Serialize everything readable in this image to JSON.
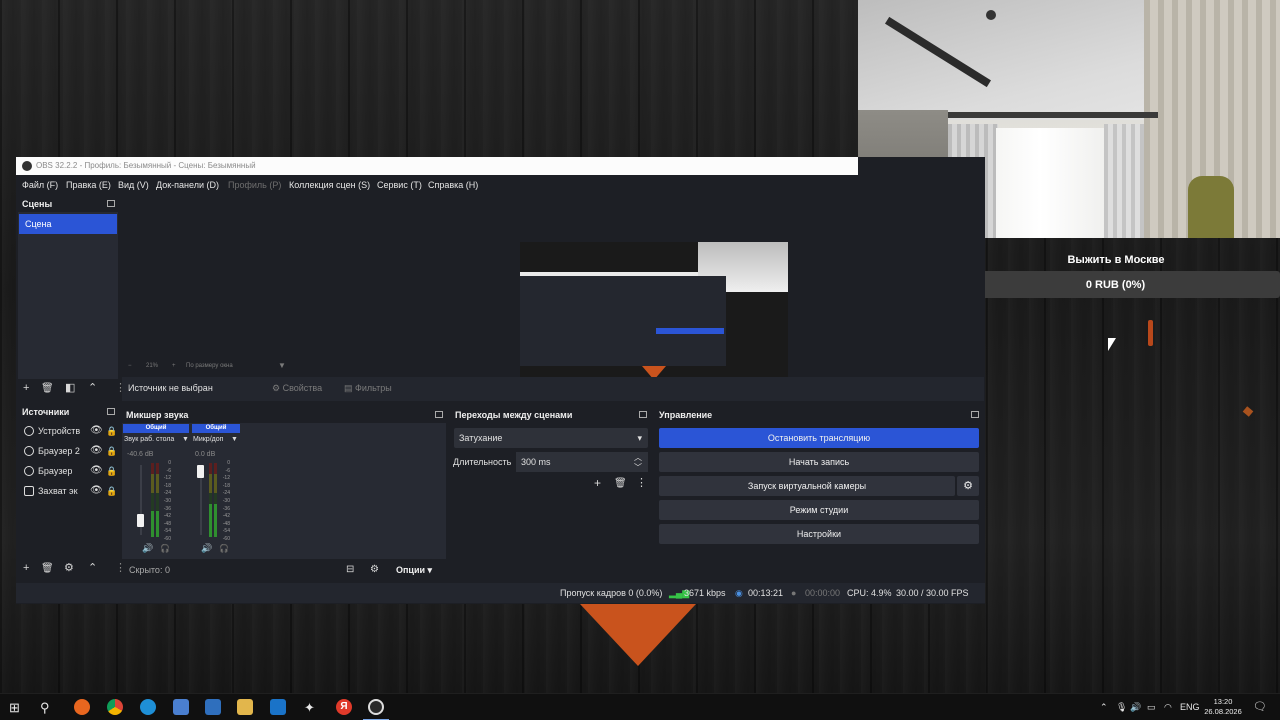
{
  "obs": {
    "title": "OBS 32.2.2 - Профиль: Безымянный - Сцены: Безымянный",
    "menu": [
      "Файл (F)",
      "Правка (E)",
      "Вид (V)",
      "Док-панели (D)",
      "Профиль (P)",
      "Коллекция сцен (S)",
      "Сервис (T)",
      "Справка (H)"
    ],
    "scenes": {
      "title": "Сцены",
      "items": [
        "Сцена"
      ]
    },
    "preview_zoom": {
      "percent": "21%",
      "mode": "По размеру окна"
    },
    "context": {
      "label": "Источник не выбран",
      "properties": "Свойства",
      "filters": "Фильтры"
    },
    "sources": {
      "title": "Источники",
      "items": [
        "Устройств",
        "Браузер 2",
        "Браузер",
        "Захват эк"
      ]
    },
    "mixer": {
      "title": "Микшер звука",
      "channels": [
        {
          "tab": "Общий",
          "name": "Звук раб. стола",
          "db": "-40.6 dB",
          "level": 0.35,
          "fader": 0.2
        },
        {
          "tab": "Общий",
          "name": "Микр/доп",
          "db": "0.0 dB",
          "level": 0.45,
          "fader": 1.0
        }
      ],
      "scale": [
        "0",
        "-6",
        "-12",
        "-18",
        "-24",
        "-30",
        "-36",
        "-42",
        "-48",
        "-54",
        "-60"
      ],
      "hidden": "Скрыто: 0",
      "options": "Опции"
    },
    "transitions": {
      "title": "Переходы между сценами",
      "selected": "Затухание",
      "duration_label": "Длительность",
      "duration_value": "300 ms"
    },
    "controls": {
      "title": "Управление",
      "stop_stream": "Остановить трансляцию",
      "start_record": "Начать запись",
      "virtual_cam": "Запуск виртуальной камеры",
      "studio_mode": "Режим студии",
      "settings": "Настройки"
    },
    "status": {
      "dropped": "Пропуск кадров 0 (0.0%)",
      "bitrate": "3671 kbps",
      "stream_time": "00:13:21",
      "record_time": "00:00:00",
      "cpu": "CPU: 4.9%",
      "fps": "30.00 / 30.00 FPS"
    }
  },
  "widget": {
    "goal_title": "Выжить в Москве",
    "goal_amount": "0 RUB (0%)",
    "goal_progress": 0.0
  },
  "taskbar": {
    "lang": "ENG",
    "time": "13:20",
    "date": "26.08.2026"
  },
  "colors": {
    "accent": "#2b55d6",
    "panel": "#272a33",
    "window_bg": "#1d1f25"
  }
}
